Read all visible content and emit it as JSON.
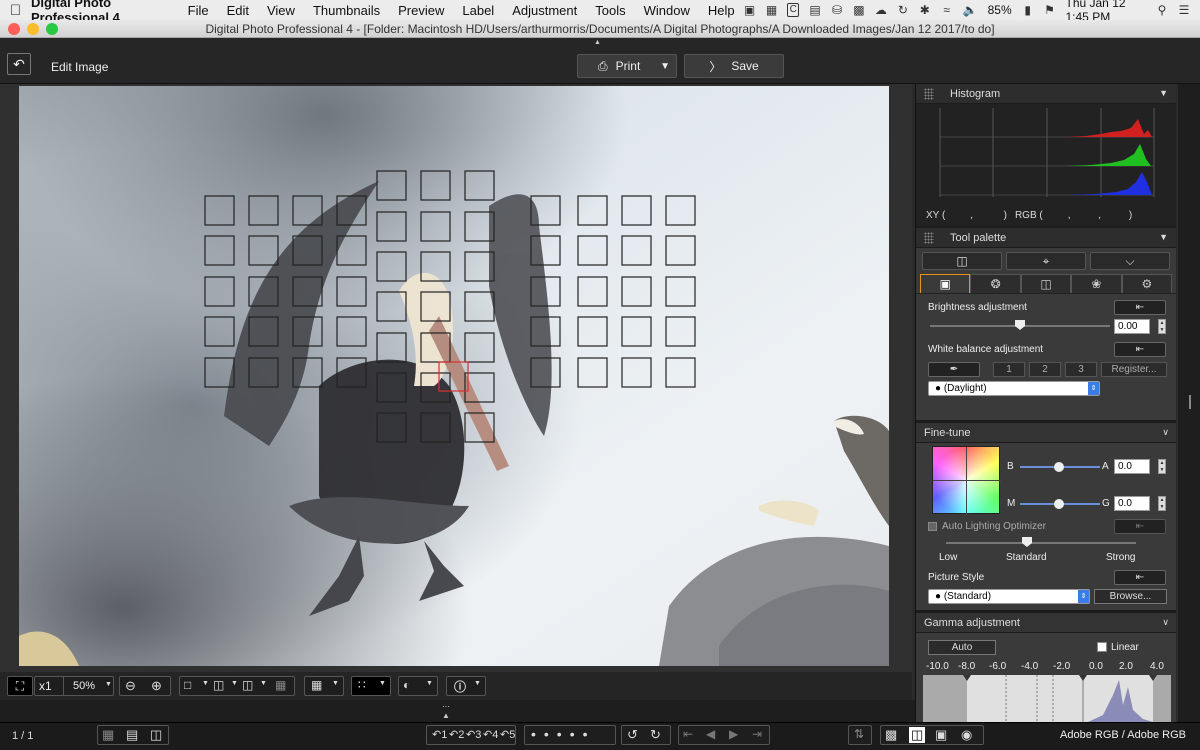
{
  "menubar": {
    "app_name": "Digital Photo Professional 4",
    "items": [
      "File",
      "Edit",
      "View",
      "Thumbnails",
      "Preview",
      "Label",
      "Adjustment",
      "Tools",
      "Window",
      "Help"
    ],
    "battery": "85%",
    "clock": "Thu Jan 12  1:45 PM"
  },
  "window": {
    "title": "Digital Photo Professional 4 - [Folder: Macintosh HD/Users/arthurmorris/Documents/A Digital Photographs/A Downloaded Images/Jan 12 2017/to do]"
  },
  "toolbar": {
    "edit_label": "Edit Image",
    "print_label": "Print",
    "save_label": "Save"
  },
  "histogram": {
    "title": "Histogram",
    "xy_label": "XY (         ,           )",
    "rgb_label": "RGB (         ,          ,          )"
  },
  "tool_palette": {
    "title": "Tool palette",
    "brightness_label": "Brightness adjustment",
    "brightness_value": "0.00",
    "brightness_level": 0.5,
    "wb_label": "White balance adjustment",
    "wb_presets": [
      "1",
      "2",
      "3"
    ],
    "register_label": "Register...",
    "wb_selected": "(Daylight)"
  },
  "fine_tune": {
    "title": "Fine-tune",
    "b_label": "B",
    "a_label": "A",
    "a_value": "0.0",
    "m_label": "M",
    "g_label": "G",
    "g_value": "0.0",
    "alo_label": "Auto Lighting Optimizer",
    "alo_levels": [
      "Low",
      "Standard",
      "Strong"
    ],
    "picture_style_label": "Picture Style",
    "picture_style_selected": "(Standard)",
    "browse_label": "Browse..."
  },
  "gamma": {
    "title": "Gamma adjustment",
    "auto_label": "Auto",
    "linear_label": "Linear",
    "scale": [
      "-10.0",
      "-8.0",
      "-6.0",
      "-4.0",
      "-2.0",
      "0.0",
      "2.0",
      "4.0"
    ]
  },
  "bottom": {
    "zoom_x1": "x1",
    "zoom_level": "50%",
    "page_count": "1 / 1",
    "rating_labels": [
      "1",
      "2",
      "3",
      "4",
      "5"
    ],
    "color_space": "Adobe RGB / Adobe RGB"
  },
  "colors": {
    "accent": "#e8941a",
    "af_active": "#d93030"
  }
}
